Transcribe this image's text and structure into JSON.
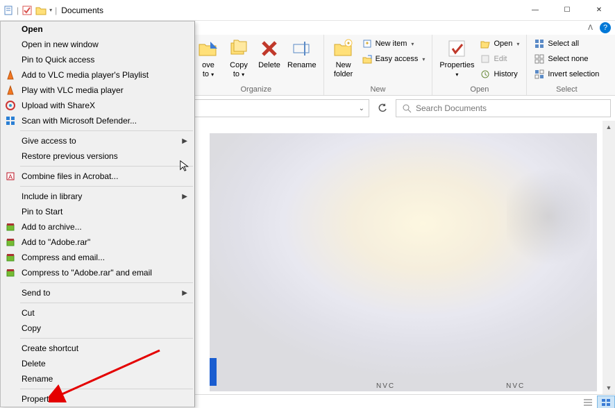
{
  "title": "Documents",
  "window_buttons": {
    "min": "—",
    "max": "☐",
    "close": "✕"
  },
  "help": "?",
  "ribbon": {
    "move": {
      "label": "ove\nto",
      "arrow": "▾"
    },
    "copy": {
      "label": "Copy\nto",
      "arrow": "▾"
    },
    "delete": {
      "label": "Delete"
    },
    "rename": {
      "label": "Rename"
    },
    "newfolder": {
      "label": "New\nfolder"
    },
    "newitem": "New item",
    "easyaccess": "Easy access",
    "properties": {
      "label": "Properties"
    },
    "open": "Open",
    "edit": "Edit",
    "history": "History",
    "selectall": "Select all",
    "selectnone": "Select none",
    "invert": "Invert selection",
    "groups": {
      "organize": "Organize",
      "new": "New",
      "open": "Open",
      "select": "Select"
    }
  },
  "search_placeholder": "Search Documents",
  "context_menu": {
    "open": "Open",
    "open_new": "Open in new window",
    "pin_quick": "Pin to Quick access",
    "add_vlc_playlist": "Add to VLC media player's Playlist",
    "play_vlc": "Play with VLC media player",
    "sharex": "Upload with ShareX",
    "defender": "Scan with Microsoft Defender...",
    "give_access": "Give access to",
    "restore": "Restore previous versions",
    "acrobat": "Combine files in Acrobat...",
    "include_library": "Include in library",
    "pin_start": "Pin to Start",
    "add_archive": "Add to archive...",
    "add_rar": "Add to \"Adobe.rar\"",
    "compress_email": "Compress and email...",
    "compress_rar_email": "Compress to \"Adobe.rar\" and email",
    "send_to": "Send to",
    "cut": "Cut",
    "copy": "Copy",
    "create_shortcut": "Create shortcut",
    "delete": "Delete",
    "rename": "Rename",
    "properties": "Properties"
  },
  "bottom_frag1": "NVC",
  "bottom_frag2": "NVC"
}
